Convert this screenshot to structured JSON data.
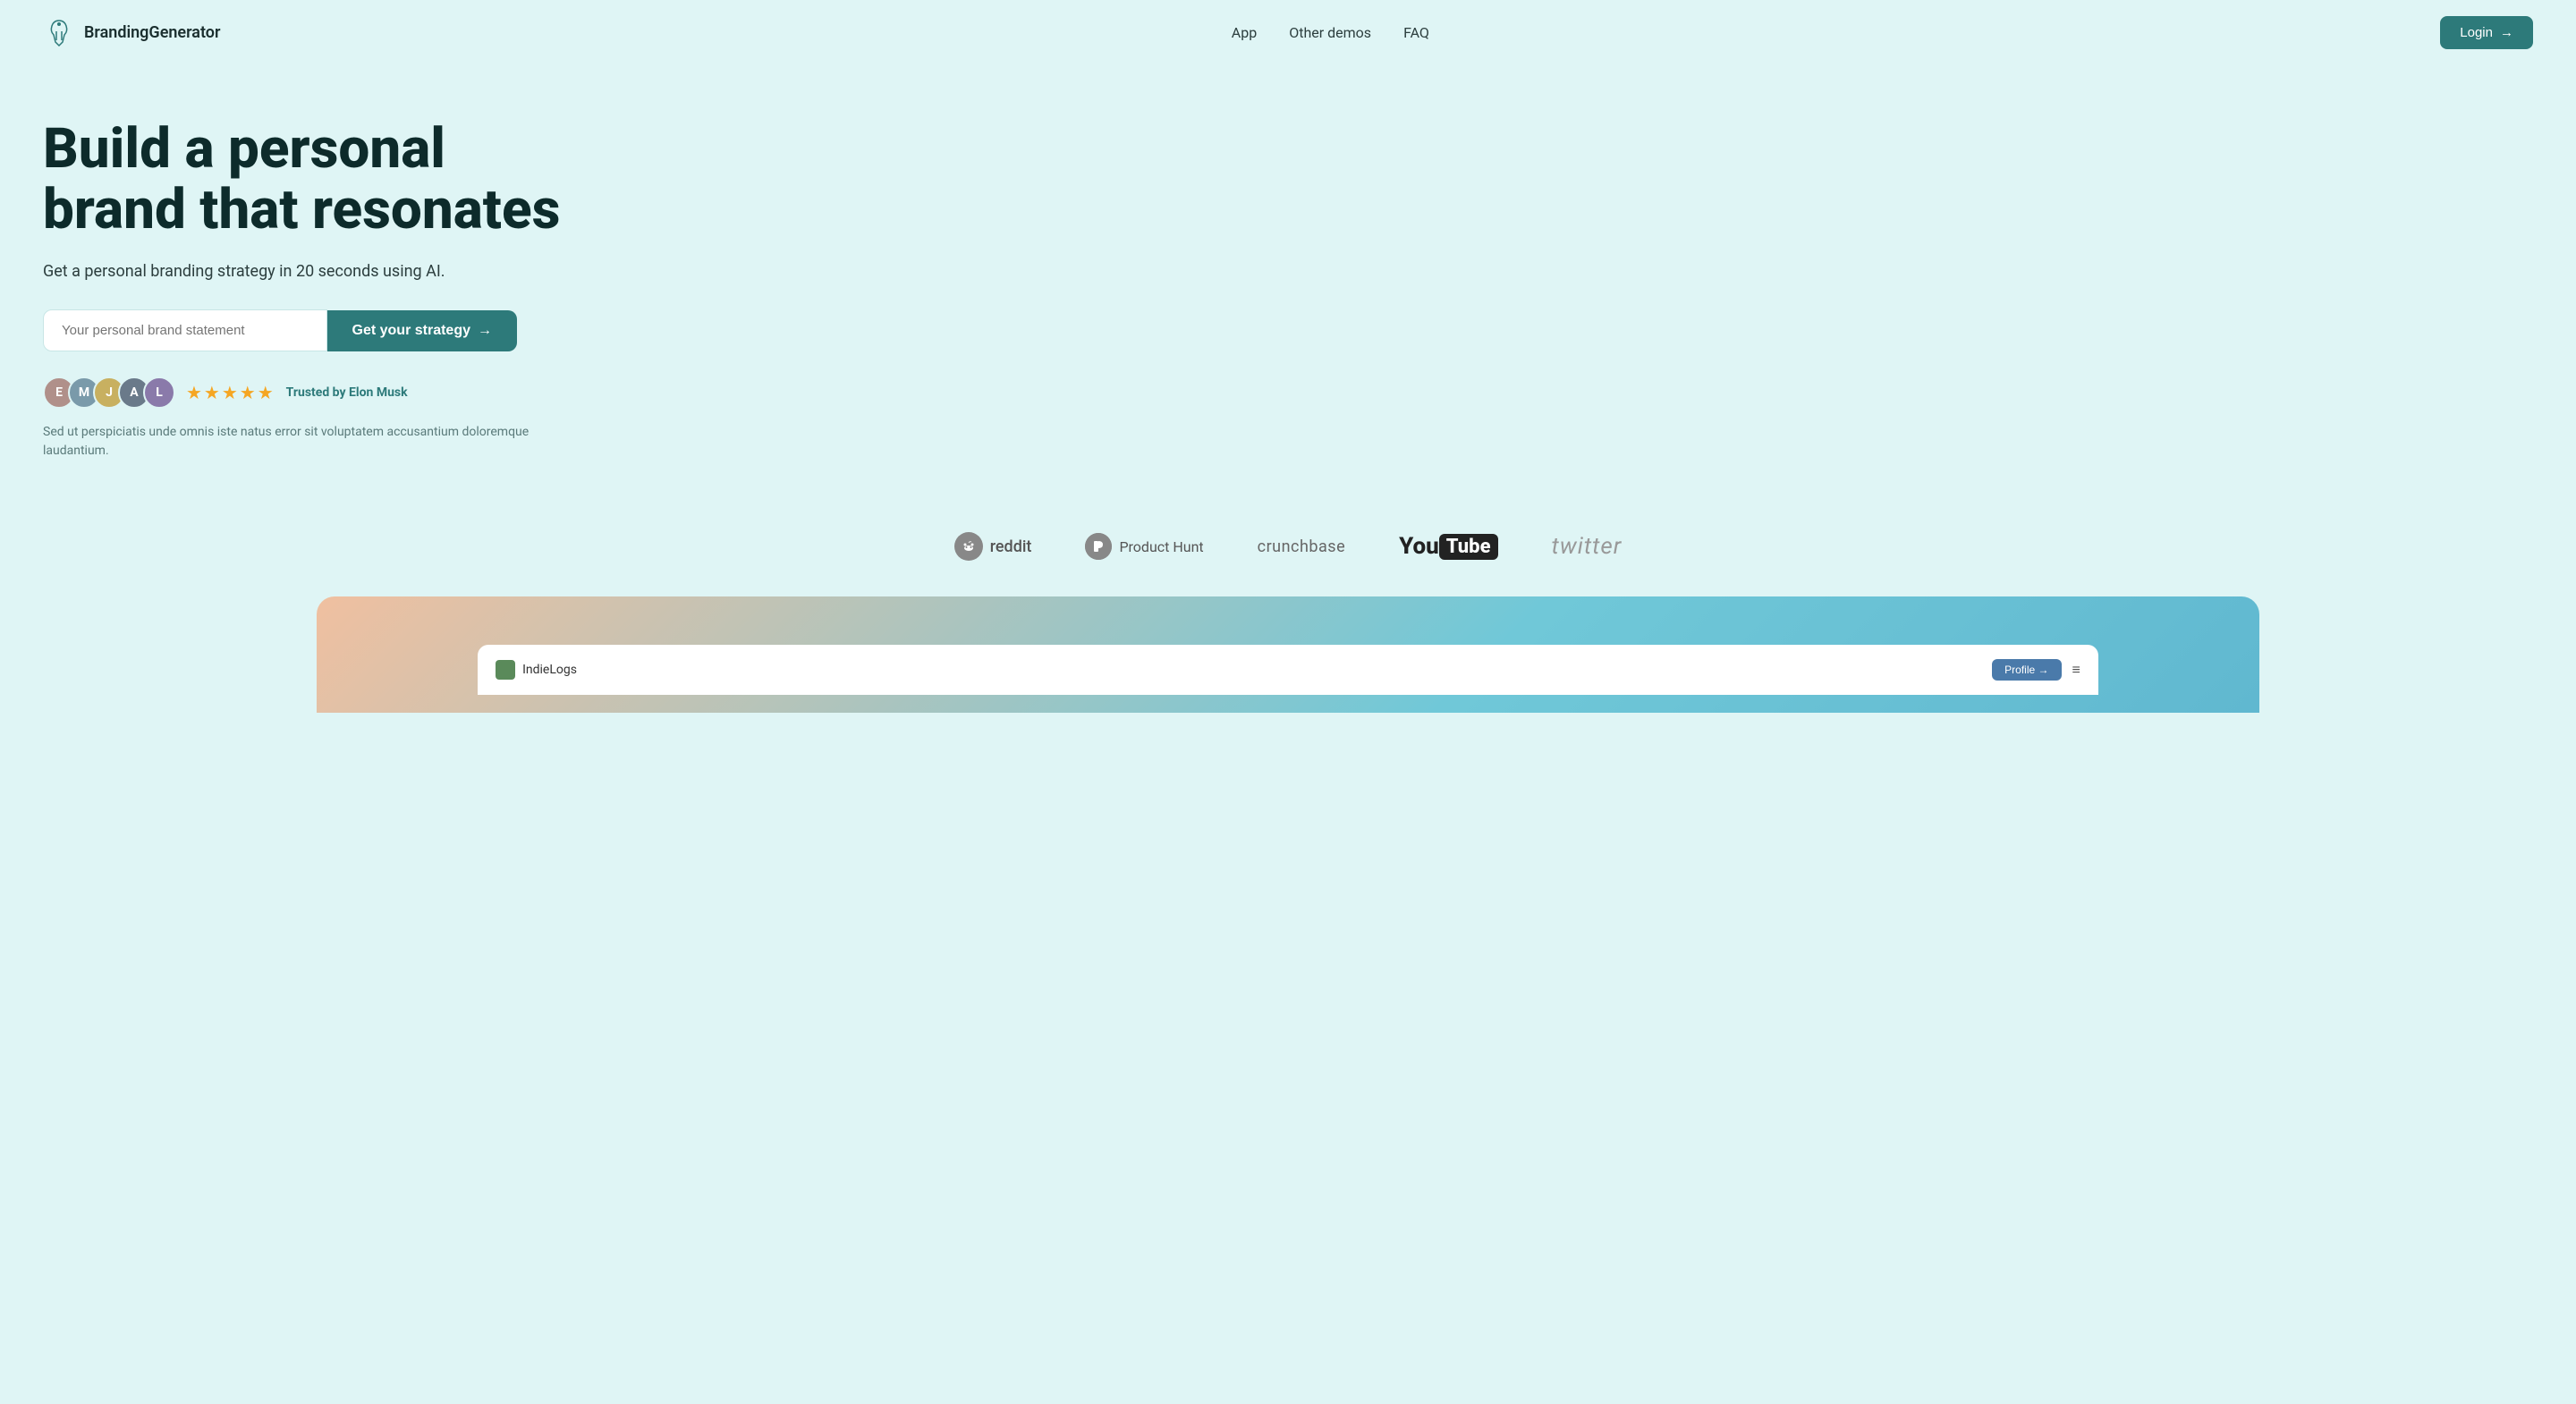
{
  "nav": {
    "logo_text": "BrandingGenerator",
    "links": [
      {
        "label": "App",
        "id": "app"
      },
      {
        "label": "Other demos",
        "id": "other-demos"
      },
      {
        "label": "FAQ",
        "id": "faq"
      }
    ],
    "login_label": "Login",
    "login_arrow": "→"
  },
  "hero": {
    "title": "Build a personal brand that resonates",
    "subtitle": "Get a personal branding strategy in 20 seconds using AI.",
    "input_placeholder": "Your personal brand statement",
    "cta_label": "Get your strategy",
    "cta_arrow": "→"
  },
  "trust": {
    "stars": "★★★★★",
    "trust_text": "Trusted by Elon Musk",
    "description": "Sed ut perspiciatis unde omnis iste natus error sit voluptatem accusantium doloremque laudantium."
  },
  "logos": [
    {
      "id": "reddit",
      "name": "reddit",
      "icon": "●"
    },
    {
      "id": "producthunt",
      "name": "Product Hunt",
      "icon": "P"
    },
    {
      "id": "crunchbase",
      "name": "crunchbase"
    },
    {
      "id": "youtube",
      "name": "YouTube"
    },
    {
      "id": "twitter",
      "name": "twitter"
    }
  ],
  "screenshot": {
    "inner_logo": "IndieLogs",
    "profile_btn": "Profile →",
    "menu_icon": "≡"
  }
}
